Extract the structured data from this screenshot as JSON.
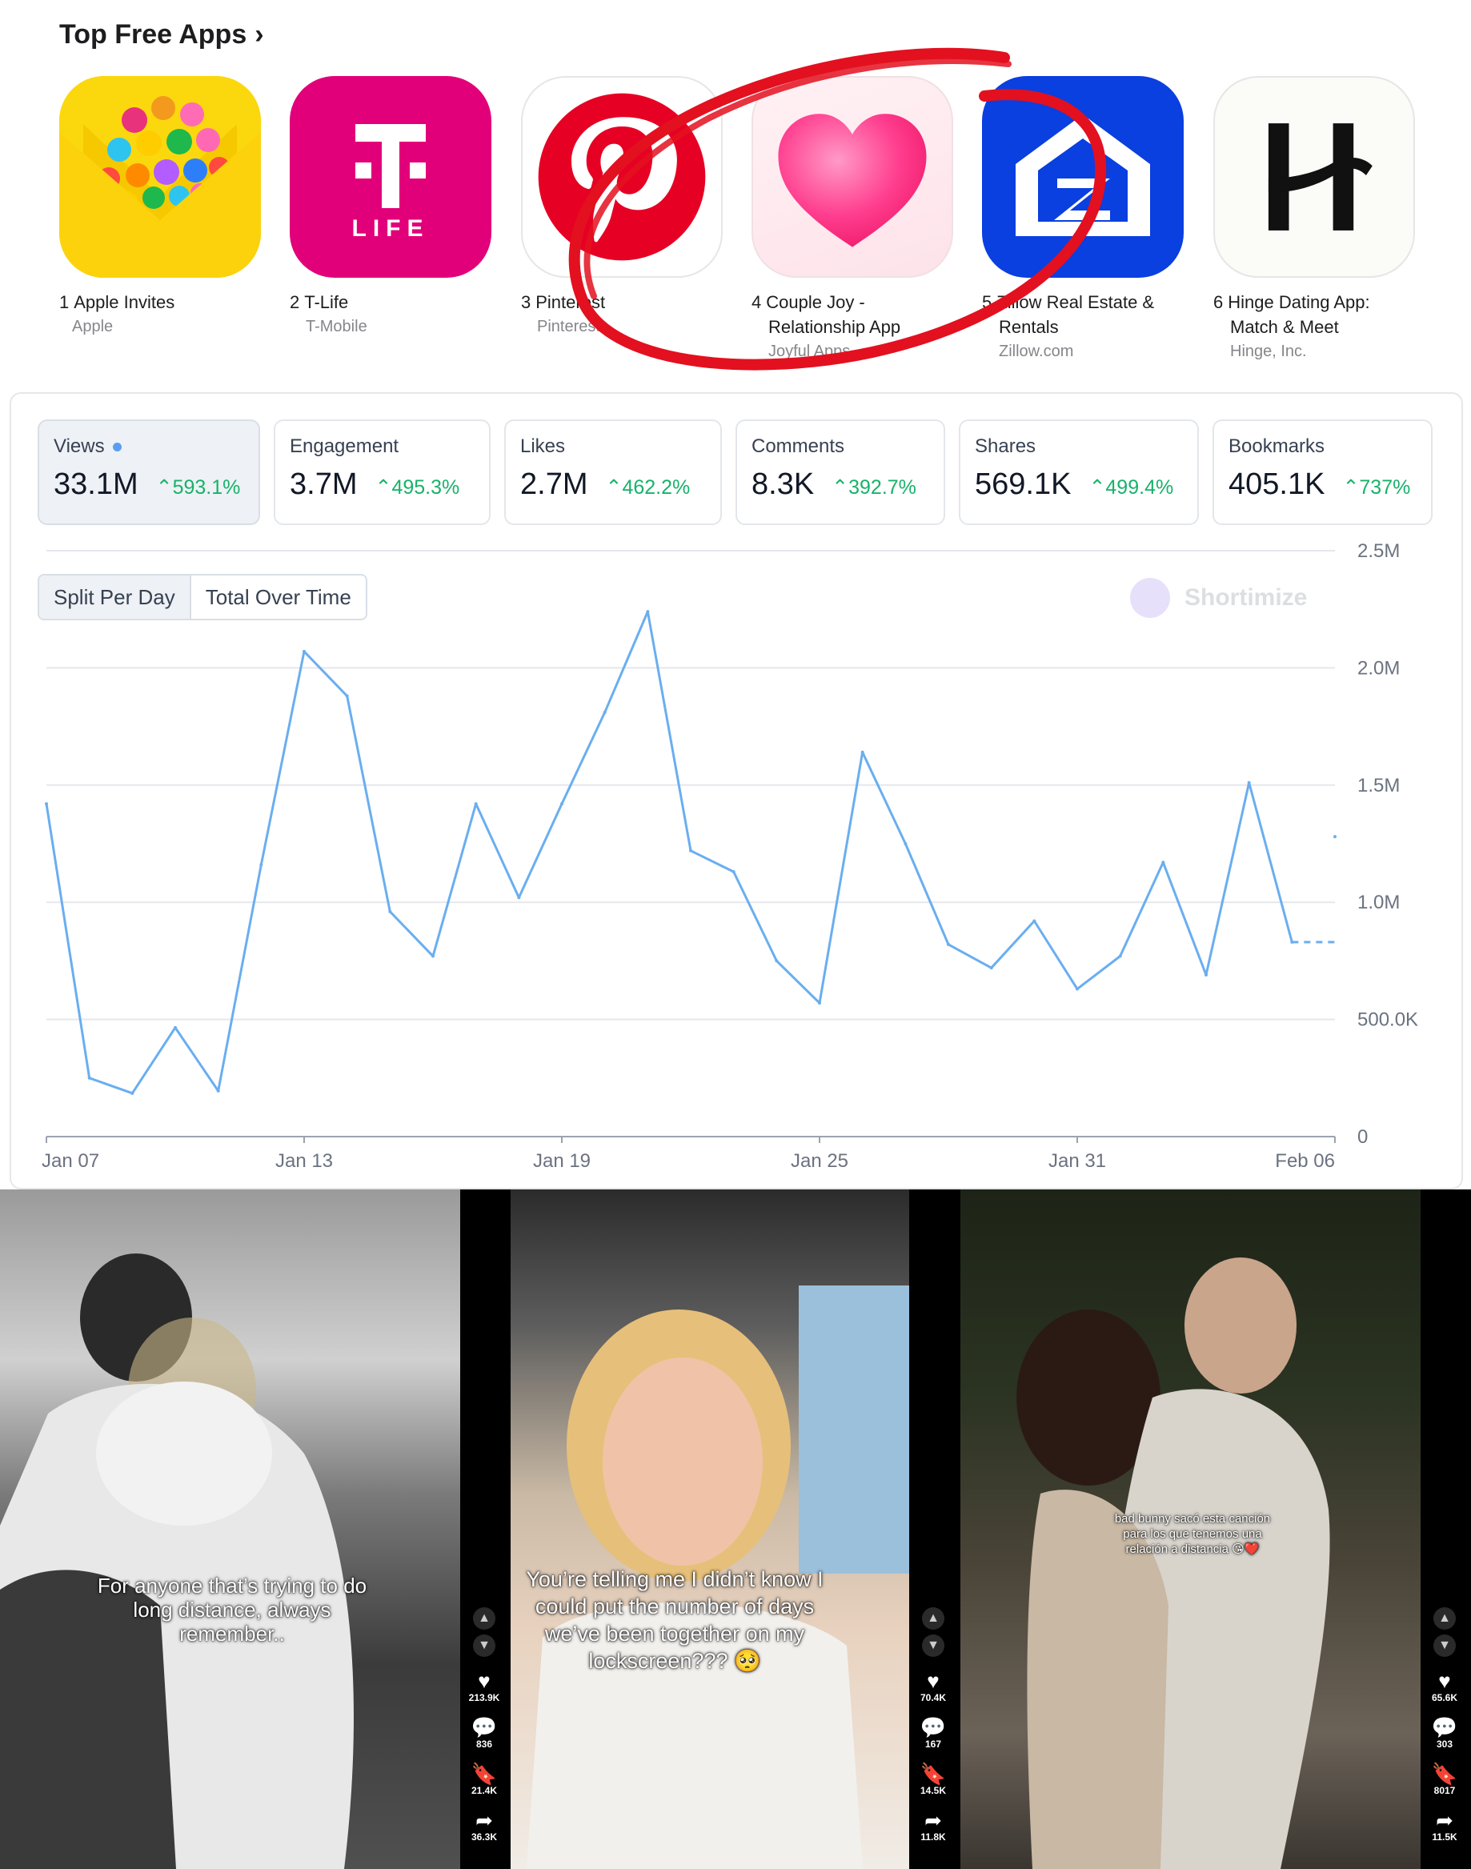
{
  "apps_section": {
    "title": "Top Free Apps",
    "chevron": "›",
    "apps": [
      {
        "rank": "1",
        "name_line1": "Apple Invites",
        "name_line2": "",
        "developer": "Apple",
        "icon": "apple-invites-icon"
      },
      {
        "rank": "2",
        "name_line1": "T-Life",
        "name_line2": "",
        "developer": "T-Mobile",
        "icon": "t-life-icon",
        "icon_text": "LIFE"
      },
      {
        "rank": "3",
        "name_line1": "Pinterest",
        "name_line2": "",
        "developer": "Pinterest",
        "icon": "pinterest-icon"
      },
      {
        "rank": "4",
        "name_line1": "Couple Joy -",
        "name_line2": "Relationship App",
        "developer": "Joyful Apps",
        "icon": "heart-icon"
      },
      {
        "rank": "5",
        "name_line1": "Zillow Real Estate &",
        "name_line2": "Rentals",
        "developer": "Zillow.com",
        "icon": "zillow-icon"
      },
      {
        "rank": "6",
        "name_line1": "Hinge Dating App:",
        "name_line2": "Match & Meet",
        "developer": "Hinge, Inc.",
        "icon": "hinge-icon"
      }
    ]
  },
  "metrics": [
    {
      "label": "Views",
      "value": "33.1M",
      "change": "593.1%",
      "active": true
    },
    {
      "label": "Engagement",
      "value": "3.7M",
      "change": "495.3%"
    },
    {
      "label": "Likes",
      "value": "2.7M",
      "change": "462.2%"
    },
    {
      "label": "Comments",
      "value": "8.3K",
      "change": "392.7%"
    },
    {
      "label": "Shares",
      "value": "569.1K",
      "change": "499.4%"
    },
    {
      "label": "Bookmarks",
      "value": "405.1K",
      "change": "737%"
    }
  ],
  "toggle": {
    "split_label": "Split Per Day",
    "total_label": "Total Over Time"
  },
  "watermark": "Shortimize",
  "colors": {
    "line": "#6aaef0",
    "positive": "#17b26a",
    "annotation": "#e3101f"
  },
  "chart_data": {
    "type": "line",
    "x": [
      "Jan 07",
      "Jan 08",
      "Jan 09",
      "Jan 10",
      "Jan 11",
      "Jan 12",
      "Jan 13",
      "Jan 14",
      "Jan 15",
      "Jan 16",
      "Jan 17",
      "Jan 18",
      "Jan 19",
      "Jan 20",
      "Jan 21",
      "Jan 22",
      "Jan 23",
      "Jan 24",
      "Jan 25",
      "Jan 26",
      "Jan 27",
      "Jan 28",
      "Jan 29",
      "Jan 30",
      "Jan 31",
      "Feb 01",
      "Feb 02",
      "Feb 03",
      "Feb 04",
      "Feb 05",
      "Feb 06"
    ],
    "series": [
      {
        "values": [
          1420000,
          250000,
          185000,
          465000,
          195000,
          1160000,
          2070000,
          1880000,
          960000,
          770000,
          1420000,
          1020000,
          1420000,
          1810000,
          2240000,
          1220000,
          1130000,
          750000,
          570000,
          1640000,
          1250000,
          820000,
          720000,
          920000,
          630000,
          770000,
          1170000,
          690000,
          1510000,
          830000,
          1280000
        ],
        "dashed_tail_from_index": 29
      }
    ],
    "x_tick_labels": [
      "Jan 07",
      "Jan 13",
      "Jan 19",
      "Jan 25",
      "Jan 31",
      "Feb 06"
    ],
    "y_tick_labels": [
      "0",
      "500.0K",
      "1.0M",
      "1.5M",
      "2.0M",
      "2.5M"
    ],
    "ylim": [
      0,
      2500000
    ],
    "grid": true
  },
  "videos": [
    {
      "caption": "For anyone that’s trying to do long distance, always remember..",
      "likes": "213.9K",
      "comments": "836",
      "bookmarks": "21.4K",
      "shares": "36.3K"
    },
    {
      "caption": "You’re telling me I didn’t know I could put the number of days we’ve been together on my lockscreen??? 🥺",
      "likes": "70.4K",
      "comments": "167",
      "bookmarks": "14.5K",
      "shares": "11.8K"
    },
    {
      "caption": "bad bunny sacó esta canción para los que tenemos una relación a distancia 😘❤️",
      "likes": "65.6K",
      "comments": "303",
      "bookmarks": "8017",
      "shares": "11.5K"
    }
  ],
  "rail_icons": {
    "up": "▲",
    "down": "▼",
    "like": "♥",
    "comment": "💬",
    "bookmark": "🔖",
    "share": "➦"
  }
}
